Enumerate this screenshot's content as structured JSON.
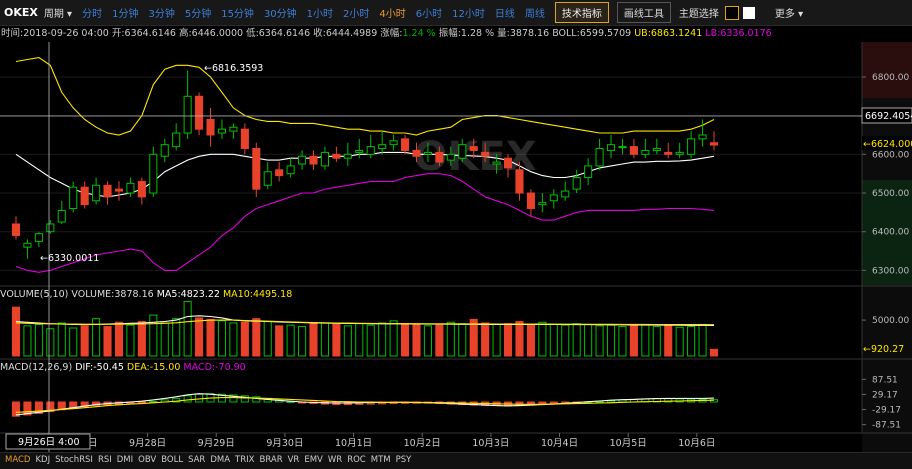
{
  "toolbar": {
    "logo": "OKEX",
    "period_label": "周期 ▾",
    "intervals": [
      {
        "label": "分时",
        "active": false
      },
      {
        "label": "1分钟",
        "active": false
      },
      {
        "label": "3分钟",
        "active": false
      },
      {
        "label": "5分钟",
        "active": false
      },
      {
        "label": "15分钟",
        "active": false
      },
      {
        "label": "30分钟",
        "active": false
      },
      {
        "label": "1小时",
        "active": false
      },
      {
        "label": "2小时",
        "active": false
      },
      {
        "label": "4小时",
        "active": true
      },
      {
        "label": "6小时",
        "active": false
      },
      {
        "label": "12小时",
        "active": false
      },
      {
        "label": "日线",
        "active": false
      },
      {
        "label": "周线",
        "active": false
      }
    ],
    "indicators_label": "技术指标",
    "drawing_label": "画线工具",
    "theme_label": "主题选择",
    "more_label": "更多 ▾",
    "theme_colors": [
      "#000000",
      "#ffffff"
    ]
  },
  "info": {
    "time_label": "时间:",
    "time": "2018-09-26  04:00",
    "open_label": "开:",
    "open": "6364.6146",
    "high_label": "高:",
    "high": "6446.0000",
    "low_label": "低:",
    "low": "6364.6146",
    "close_label": "收:",
    "close": "6444.4989",
    "change_label": "涨幅:",
    "change": "1.24 %",
    "amplitude_label": "振幅:",
    "amplitude": "1.28 %",
    "volume_label": "量:",
    "volume": "3878.16",
    "boll_label": "BOLL:",
    "boll": "6599.5709",
    "ub_label": "UB:",
    "ub": "6863.1241",
    "lb_label": "LB:",
    "lb": "6336.0176"
  },
  "price_axis": {
    "ticks": [
      "6800.00",
      "6700.00",
      "6600.00",
      "6500.00",
      "6400.00",
      "6300.00"
    ],
    "crosshair_value": "6692.4054",
    "last_price": "6624.0000",
    "annotation_high": "6816.3593",
    "annotation_low": "6330.0011"
  },
  "volume_panel": {
    "header": "VOLUME(5,10)",
    "volume_label": "VOLUME:",
    "volume": "3878.16",
    "ma5_label": "MA5:",
    "ma5": "4823.22",
    "ma10_label": "MA10:",
    "ma10": "4495.18",
    "tick": "5000.00",
    "last_value": "920.27"
  },
  "macd_panel": {
    "header": "MACD(12,26,9)",
    "dif_label": "DIF:",
    "dif": "-50.45",
    "dea_label": "DEA:",
    "dea": "-15.00",
    "macd_label": "MACD:",
    "macd": "-70.90",
    "ticks": [
      "87.51",
      "29.17",
      "-29.17",
      "-87.51"
    ]
  },
  "x_axis": {
    "crosshair_label": "9月26日   4:00",
    "labels": [
      "9月27日",
      "9月28日",
      "9月29日",
      "9月30日",
      "10月1日",
      "10月2日",
      "10月3日",
      "10月4日",
      "10月5日",
      "10月6日"
    ]
  },
  "watermark": "OKEX",
  "bottom_tabs": [
    {
      "label": "MACD",
      "active": true
    },
    {
      "label": "KDJ",
      "active": false
    },
    {
      "label": "StochRSI",
      "active": false
    },
    {
      "label": "RSI",
      "active": false
    },
    {
      "label": "DMI",
      "active": false
    },
    {
      "label": "OBV",
      "active": false
    },
    {
      "label": "BOLL",
      "active": false
    },
    {
      "label": "SAR",
      "active": false
    },
    {
      "label": "DMA",
      "active": false
    },
    {
      "label": "TRIX",
      "active": false
    },
    {
      "label": "BRAR",
      "active": false
    },
    {
      "label": "VR",
      "active": false
    },
    {
      "label": "EMV",
      "active": false
    },
    {
      "label": "WR",
      "active": false
    },
    {
      "label": "ROC",
      "active": false
    },
    {
      "label": "MTM",
      "active": false
    },
    {
      "label": "PSY",
      "active": false
    }
  ],
  "colors": {
    "up": "#00c000",
    "down": "#e8432a",
    "ub": "#ffe600",
    "lb": "#e000e0",
    "mid": "#ffffff"
  },
  "chart_data": {
    "type": "candlestick",
    "price_range": [
      6270,
      6880
    ],
    "x": [
      "9月26日 4:00",
      "9月26日 8:00",
      "9月26日 12:00",
      "9月26日 16:00",
      "9月26日 20:00",
      "9月27日 0:00",
      "9月27日 4:00",
      "9月27日 8:00",
      "9月27日 12:00",
      "9月27日 16:00",
      "9月27日 20:00",
      "9月28日 0:00",
      "9月28日 4:00",
      "9月28日 8:00",
      "9月28日 12:00",
      "9月28日 16:00",
      "9月28日 20:00",
      "9月29日 0:00",
      "9月29日 4:00",
      "9月29日 8:00",
      "9月29日 12:00",
      "9月29日 16:00",
      "9月29日 20:00",
      "9月30日 0:00",
      "9月30日 4:00",
      "9月30日 8:00",
      "9月30日 12:00",
      "9月30日 16:00",
      "9月30日 20:00",
      "10月1日 0:00",
      "10月1日 4:00",
      "10月1日 8:00",
      "10月1日 12:00",
      "10月1日 16:00",
      "10月1日 20:00",
      "10月2日 0:00",
      "10月2日 4:00",
      "10月2日 8:00",
      "10月2日 12:00",
      "10月2日 16:00",
      "10月2日 20:00",
      "10月3日 0:00",
      "10月3日 4:00",
      "10月3日 8:00",
      "10月3日 12:00",
      "10月3日 16:00",
      "10月3日 20:00",
      "10月4日 0:00",
      "10月4日 4:00",
      "10月4日 8:00",
      "10月4日 12:00",
      "10月4日 16:00",
      "10月4日 20:00",
      "10月5日 0:00",
      "10月5日 4:00",
      "10月5日 8:00",
      "10月5日 12:00",
      "10月5日 16:00",
      "10月5日 20:00",
      "10月6日 0:00",
      "10月6日 4:00",
      "10月6日 8:00"
    ],
    "open": [
      6420,
      6360,
      6375,
      6400,
      6425,
      6460,
      6515,
      6480,
      6520,
      6510,
      6500,
      6530,
      6500,
      6595,
      6620,
      6655,
      6750,
      6690,
      6655,
      6660,
      6665,
      6615,
      6520,
      6560,
      6550,
      6575,
      6595,
      6570,
      6600,
      6590,
      6605,
      6600,
      6615,
      6625,
      6640,
      6610,
      6600,
      6605,
      6585,
      6590,
      6620,
      6605,
      6575,
      6590,
      6560,
      6500,
      6470,
      6480,
      6490,
      6510,
      6540,
      6570,
      6610,
      6620,
      6620,
      6600,
      6610,
      6605,
      6600,
      6600,
      6640,
      6630
    ],
    "close": [
      6390,
      6370,
      6395,
      6420,
      6455,
      6515,
      6470,
      6520,
      6490,
      6505,
      6525,
      6490,
      6600,
      6625,
      6655,
      6750,
      6665,
      6650,
      6665,
      6670,
      6615,
      6510,
      6555,
      6545,
      6570,
      6595,
      6575,
      6605,
      6590,
      6600,
      6610,
      6620,
      6625,
      6635,
      6610,
      6595,
      6605,
      6580,
      6600,
      6625,
      6610,
      6595,
      6580,
      6565,
      6500,
      6460,
      6475,
      6495,
      6505,
      6540,
      6570,
      6615,
      6625,
      6620,
      6600,
      6610,
      6615,
      6600,
      6605,
      6640,
      6650,
      6624
    ],
    "high": [
      6440,
      6380,
      6400,
      6430,
      6480,
      6530,
      6530,
      6540,
      6530,
      6530,
      6540,
      6540,
      6620,
      6640,
      6680,
      6816.3593,
      6760,
      6720,
      6690,
      6680,
      6680,
      6630,
      6580,
      6580,
      6590,
      6610,
      6610,
      6620,
      6620,
      6630,
      6640,
      6650,
      6660,
      6650,
      6650,
      6630,
      6630,
      6620,
      6620,
      6640,
      6640,
      6630,
      6600,
      6600,
      6580,
      6510,
      6500,
      6510,
      6530,
      6560,
      6590,
      6640,
      6650,
      6640,
      6640,
      6640,
      6640,
      6630,
      6630,
      6660,
      6690,
      6660
    ],
    "low": [
      6380,
      6330.0011,
      6360,
      6395,
      6420,
      6450,
      6460,
      6470,
      6470,
      6480,
      6490,
      6470,
      6490,
      6580,
      6610,
      6640,
      6650,
      6620,
      6640,
      6640,
      6600,
      6490,
      6510,
      6530,
      6540,
      6560,
      6560,
      6560,
      6580,
      6570,
      6590,
      6590,
      6600,
      6610,
      6600,
      6580,
      6580,
      6570,
      6570,
      6580,
      6590,
      6580,
      6550,
      6540,
      6480,
      6440,
      6450,
      6460,
      6480,
      6500,
      6520,
      6560,
      6590,
      6600,
      6590,
      6590,
      6600,
      6590,
      6590,
      6590,
      6620,
      6610
    ],
    "boll_ub": [
      6840,
      6845,
      6850,
      6830,
      6760,
      6720,
      6690,
      6670,
      6655,
      6650,
      6660,
      6700,
      6780,
      6820,
      6830,
      6830,
      6825,
      6800,
      6760,
      6720,
      6700,
      6690,
      6685,
      6685,
      6680,
      6680,
      6680,
      6675,
      6670,
      6665,
      6665,
      6660,
      6660,
      6655,
      6655,
      6650,
      6660,
      6665,
      6670,
      6690,
      6695,
      6700,
      6700,
      6695,
      6690,
      6685,
      6680,
      6675,
      6670,
      6665,
      6660,
      6655,
      6655,
      6655,
      6660,
      6660,
      6660,
      6660,
      6660,
      6665,
      6675,
      6690
    ],
    "boll_mid": [
      6600,
      6580,
      6560,
      6540,
      6525,
      6510,
      6500,
      6495,
      6490,
      6495,
      6500,
      6510,
      6530,
      6555,
      6570,
      6585,
      6595,
      6600,
      6600,
      6600,
      6595,
      6590,
      6585,
      6585,
      6590,
      6590,
      6590,
      6595,
      6595,
      6595,
      6600,
      6600,
      6605,
      6605,
      6605,
      6600,
      6600,
      6600,
      6598,
      6597,
      6596,
      6594,
      6590,
      6585,
      6570,
      6555,
      6545,
      6540,
      6540,
      6545,
      6555,
      6565,
      6570,
      6575,
      6580,
      6580,
      6582,
      6582,
      6583,
      6585,
      6590,
      6595
    ],
    "boll_lb": [
      6310,
      6300,
      6295,
      6300,
      6310,
      6320,
      6330,
      6340,
      6345,
      6350,
      6355,
      6350,
      6320,
      6300,
      6300,
      6320,
      6340,
      6360,
      6390,
      6410,
      6440,
      6460,
      6470,
      6480,
      6490,
      6500,
      6500,
      6510,
      6515,
      6520,
      6525,
      6530,
      6530,
      6530,
      6540,
      6545,
      6550,
      6550,
      6545,
      6530,
      6510,
      6490,
      6480,
      6470,
      6455,
      6440,
      6430,
      6430,
      6440,
      6450,
      6455,
      6455,
      6455,
      6455,
      6455,
      6458,
      6458,
      6460,
      6460,
      6460,
      6458,
      6455
    ],
    "volume_range": [
      0,
      7800
    ],
    "volume": [
      6800,
      4200,
      4400,
      3800,
      4600,
      3900,
      4200,
      5200,
      4100,
      4700,
      4300,
      4800,
      5700,
      4600,
      5200,
      7600,
      5300,
      5100,
      4900,
      4600,
      4700,
      5200,
      4800,
      4200,
      4300,
      4100,
      4500,
      4600,
      4400,
      4200,
      4500,
      4300,
      4600,
      4900,
      4500,
      4400,
      4200,
      4300,
      4700,
      4500,
      5100,
      4600,
      4400,
      4500,
      4800,
      4300,
      4700,
      4400,
      4300,
      4500,
      4400,
      4200,
      4300,
      4100,
      4200,
      4300,
      4100,
      4200,
      4000,
      4100,
      4400,
      920.27
    ],
    "vol_ma5": [
      4800,
      4700,
      4600,
      4500,
      4450,
      4400,
      4380,
      4400,
      4450,
      4500,
      4550,
      4600,
      4700,
      4800,
      5000,
      5500,
      5600,
      5500,
      5300,
      5000,
      4900,
      4850,
      4800,
      4750,
      4700,
      4650,
      4600,
      4580,
      4560,
      4540,
      4520,
      4500,
      4490,
      4480,
      4470,
      4460,
      4450,
      4440,
      4430,
      4420,
      4410,
      4400,
      4400,
      4400,
      4400,
      4400,
      4400,
      4400,
      4390,
      4380,
      4370,
      4360,
      4350,
      4340,
      4330,
      4320,
      4310,
      4300,
      4290,
      4280,
      4270,
      4260
    ],
    "vol_ma10": [
      4600,
      4550,
      4500,
      4480,
      4460,
      4440,
      4430,
      4420,
      4420,
      4430,
      4440,
      4460,
      4500,
      4560,
      4620,
      4780,
      4900,
      4980,
      5000,
      5000,
      4950,
      4900,
      4850,
      4800,
      4750,
      4700,
      4650,
      4620,
      4600,
      4580,
      4560,
      4540,
      4520,
      4510,
      4500,
      4495,
      4490,
      4485,
      4480,
      4475,
      4470,
      4465,
      4460,
      4455,
      4450,
      4445,
      4440,
      4435,
      4430,
      4425,
      4420,
      4415,
      4410,
      4405,
      4400,
      4395,
      4390,
      4385,
      4380,
      4375,
      4370,
      4365
    ],
    "macd_range": [
      -116,
      116
    ],
    "macd_hist": [
      -55,
      -50,
      -44,
      -37,
      -30,
      -24,
      -18,
      -13,
      -10,
      -8,
      -6,
      -4,
      2,
      8,
      14,
      24,
      30,
      32,
      30,
      27,
      24,
      20,
      14,
      8,
      2,
      -4,
      -6,
      -8,
      -10,
      -10,
      -9,
      -8,
      -7,
      -6,
      -5,
      -5,
      -4,
      -6,
      -8,
      -10,
      -12,
      -13,
      -14,
      -15,
      -14,
      -12,
      -10,
      -8,
      -6,
      -3,
      0,
      3,
      6,
      8,
      10,
      12,
      13,
      13,
      12,
      11,
      10,
      9
    ],
    "macd_dif": [
      -50,
      -45,
      -40,
      -34,
      -28,
      -22,
      -16,
      -10,
      -6,
      -3,
      0,
      3,
      8,
      14,
      20,
      28,
      32,
      30,
      26,
      22,
      18,
      14,
      10,
      6,
      3,
      0,
      -2,
      -3,
      -4,
      -4,
      -3,
      -2,
      -2,
      -1,
      -1,
      -2,
      -3,
      -4,
      -6,
      -8,
      -10,
      -12,
      -14,
      -15,
      -14,
      -12,
      -10,
      -8,
      -5,
      -2,
      1,
      4,
      7,
      9,
      10,
      12,
      13,
      14,
      14,
      14,
      14,
      15
    ],
    "macd_dea": [
      -40,
      -38,
      -35,
      -32,
      -29,
      -26,
      -22,
      -18,
      -14,
      -11,
      -8,
      -6,
      -3,
      0,
      3,
      8,
      12,
      15,
      17,
      17,
      16,
      15,
      14,
      12,
      10,
      8,
      6,
      4,
      2,
      1,
      0,
      0,
      -1,
      -1,
      -1,
      -1,
      -2,
      -2,
      -3,
      -4,
      -5,
      -6,
      -7,
      -8,
      -9,
      -9,
      -9,
      -8,
      -7,
      -6,
      -5,
      -4,
      -3,
      -1,
      0,
      1,
      2,
      3,
      4,
      5,
      6,
      7
    ]
  }
}
